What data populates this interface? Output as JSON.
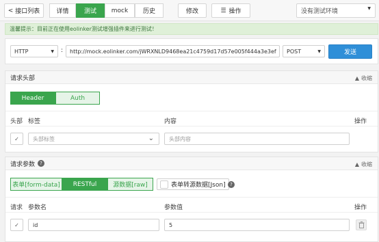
{
  "toolbar": {
    "back_label": "接口列表",
    "tabs": [
      "详情",
      "测试",
      "mock",
      "历史"
    ],
    "edit_label": "修改",
    "ops_label": "操作",
    "env_selected": "没有测试环境"
  },
  "tip": {
    "text": "温馨提示：目前正在使用eolinker测试增强插件来进行测试！"
  },
  "request": {
    "protocol": "HTTP",
    "url_prefix": "http://",
    "url": "mock.eolinker.com/jWRXNLD9468ea21c4759d17d57e005f444a3e3ef",
    "method": "POST",
    "send_label": "发送"
  },
  "headers_panel": {
    "title": "请求头部",
    "collapse_label": "收缩",
    "tabs": [
      "Header",
      "Auth"
    ],
    "cols": {
      "part": "头部",
      "tag": "标签",
      "content": "内容",
      "op": "操作"
    },
    "row": {
      "tag_placeholder": "头部标签",
      "content_placeholder": "头部内容"
    }
  },
  "params_panel": {
    "title": "请求参数",
    "collapse_label": "收缩",
    "tabs": [
      "表单[form-data]",
      "RESTful",
      "源数据[raw]"
    ],
    "convert_label": "表单转源数据[Json]",
    "cols": {
      "req": "请求",
      "name": "参数名",
      "value": "参数值",
      "op": "操作"
    },
    "row": {
      "name": "id",
      "value": "5"
    }
  },
  "colors": {
    "accent": "#3aa54d",
    "send": "#2f8fd8"
  }
}
